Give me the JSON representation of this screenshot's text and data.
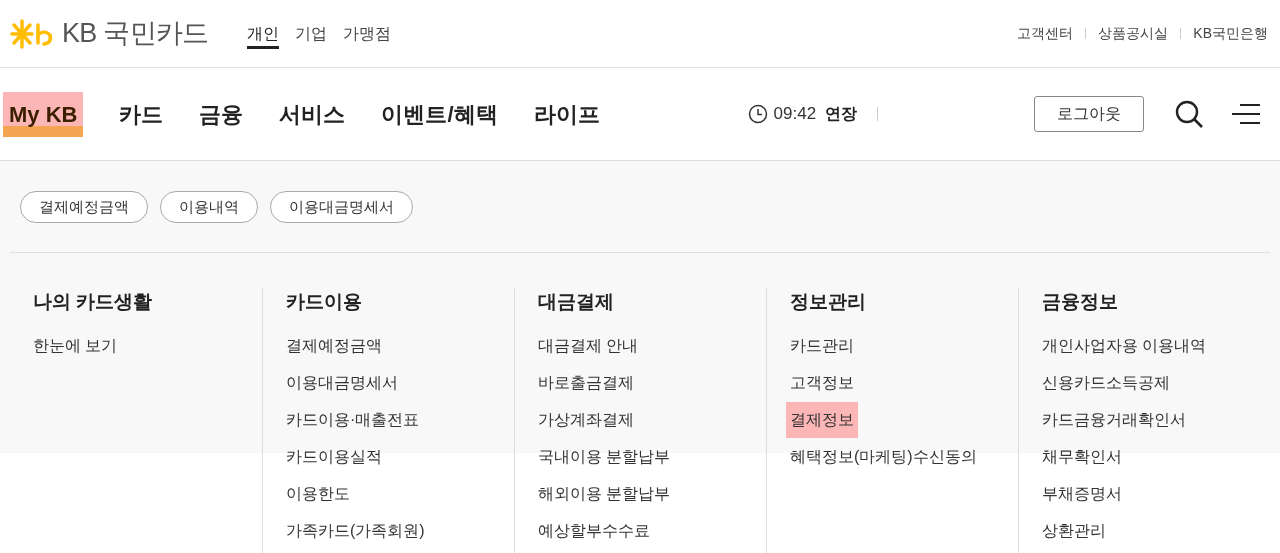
{
  "logo": {
    "text": "KB 국민카드"
  },
  "segments": [
    {
      "label": "개인",
      "selected": true
    },
    {
      "label": "기업",
      "selected": false
    },
    {
      "label": "가맹점",
      "selected": false
    }
  ],
  "util_links": [
    "고객센터",
    "상품공시실",
    "KB국민은행"
  ],
  "main_nav": [
    {
      "label": "My KB",
      "highlighted": true
    },
    {
      "label": "카드",
      "highlighted": false
    },
    {
      "label": "금융",
      "highlighted": false
    },
    {
      "label": "서비스",
      "highlighted": false
    },
    {
      "label": "이벤트/혜택",
      "highlighted": false
    },
    {
      "label": "라이프",
      "highlighted": false
    }
  ],
  "session": {
    "time": "09:42",
    "extend": "연장"
  },
  "logout_button": "로그아웃",
  "quick_links": [
    "결제예정금액",
    "이용내역",
    "이용대금명세서"
  ],
  "menu_columns": [
    {
      "title": "나의 카드생활",
      "items": [
        {
          "label": "한눈에 보기",
          "highlighted": false
        }
      ]
    },
    {
      "title": "카드이용",
      "items": [
        {
          "label": "결제예정금액",
          "highlighted": false
        },
        {
          "label": "이용대금명세서",
          "highlighted": false
        },
        {
          "label": "카드이용·매출전표",
          "highlighted": false
        },
        {
          "label": "카드이용실적",
          "highlighted": false
        },
        {
          "label": "이용한도",
          "highlighted": false
        },
        {
          "label": "가족카드(가족회원)",
          "highlighted": false
        }
      ]
    },
    {
      "title": "대금결제",
      "items": [
        {
          "label": "대금결제 안내",
          "highlighted": false
        },
        {
          "label": "바로출금결제",
          "highlighted": false
        },
        {
          "label": "가상계좌결제",
          "highlighted": false
        },
        {
          "label": "국내이용 분할납부",
          "highlighted": false
        },
        {
          "label": "해외이용 분할납부",
          "highlighted": false
        },
        {
          "label": "예상할부수수료",
          "highlighted": false
        }
      ]
    },
    {
      "title": "정보관리",
      "items": [
        {
          "label": "카드관리",
          "highlighted": false
        },
        {
          "label": "고객정보",
          "highlighted": false
        },
        {
          "label": "결제정보",
          "highlighted": true
        },
        {
          "label": "혜택정보(마케팅)수신동의",
          "highlighted": false
        }
      ]
    },
    {
      "title": "금융정보",
      "items": [
        {
          "label": "개인사업자용 이용내역",
          "highlighted": false
        },
        {
          "label": "신용카드소득공제",
          "highlighted": false
        },
        {
          "label": "카드금융거래확인서",
          "highlighted": false
        },
        {
          "label": "채무확인서",
          "highlighted": false
        },
        {
          "label": "부채증명서",
          "highlighted": false
        },
        {
          "label": "상환관리",
          "highlighted": false
        }
      ]
    }
  ]
}
